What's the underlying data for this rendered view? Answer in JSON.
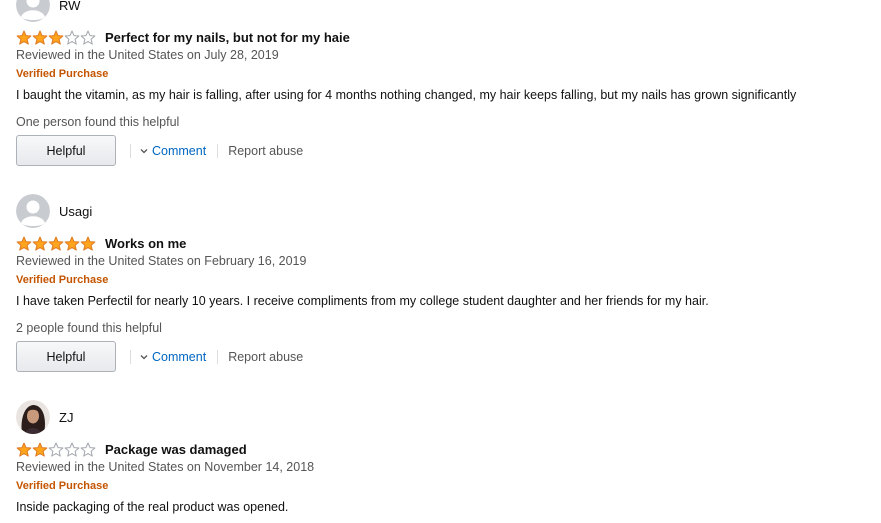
{
  "reviews": [
    {
      "author": "RW",
      "avatar_type": "default-person-icon",
      "rating": 3,
      "title": "Perfect for my nails, but not for my haie",
      "date": "Reviewed in the United States on July 28, 2019",
      "badge": "Verified Purchase",
      "body": "I baught the vitamin, as my hair is falling, after using for 4 months nothing changed, my hair keeps falling, but my nails has grown significantly",
      "helpful_count": "One person found this helpful",
      "helpful_label": "Helpful",
      "comment_label": "Comment",
      "report_label": "Report abuse"
    },
    {
      "author": "Usagi",
      "avatar_type": "default-person-icon",
      "rating": 5,
      "title": "Works on me",
      "date": "Reviewed in the United States on February 16, 2019",
      "badge": "Verified Purchase",
      "body": "I have taken Perfectil for nearly 10 years. I receive compliments from my college student daughter and her friends for my hair.",
      "helpful_count": "2 people found this helpful",
      "helpful_label": "Helpful",
      "comment_label": "Comment",
      "report_label": "Report abuse"
    },
    {
      "author": "ZJ",
      "avatar_type": "photo",
      "rating": 2,
      "title": "Package was damaged",
      "date": "Reviewed in the United States on November 14, 2018",
      "badge": "Verified Purchase",
      "body": "Inside packaging of the real product was opened."
    }
  ],
  "colors": {
    "star_fill": "#ffa41c",
    "star_stroke": "#de7921",
    "verified": "#c45500",
    "link": "#0066c0",
    "muted": "#555555"
  }
}
